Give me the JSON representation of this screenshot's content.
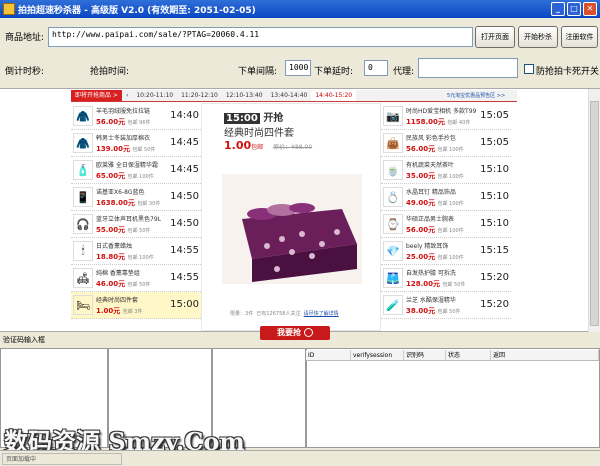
{
  "window": {
    "title": "拍拍超速秒杀器 - 高级版 V2.0 (有效期至: 2051-02-05)"
  },
  "form": {
    "url_label": "商品地址:",
    "url_value": "http://www.paipai.com/sale/?PTAG=20060.4.11",
    "countdown_label": "倒计时秒:",
    "snap_time_label": "抢拍时间:",
    "order_interval_label": "下单间隔:",
    "order_interval_value": "1000",
    "order_delay_label": "下单延时:",
    "order_delay_value": "0",
    "proxy_label": "代理:",
    "proxy_value": "",
    "prevent_freeze_label": "防抢拍卡死开关"
  },
  "buttons": {
    "open_page": "打开页面",
    "start_snap": "开始秒杀",
    "auth": "注册软件"
  },
  "tabs": {
    "lead": "即将开抢商品 >",
    "items": [
      "10:20-11:10",
      "11:20-12:10",
      "12:10-13:40",
      "13:40-14:40",
      "14:40-15:20"
    ],
    "active": 4,
    "link": "5元淘宝优惠品预告区 >>"
  },
  "left_items": [
    {
      "name": "羊毛羽绒服免拉拉链",
      "price": "56.00元",
      "sub": "包邮 96件",
      "time": "14:40",
      "icon": "coat-icon",
      "glyph": "🧥"
    },
    {
      "name": "韩男士冬装加厚棉衣",
      "price": "139.00元",
      "sub": "包邮 50件",
      "time": "14:45",
      "icon": "jacket-icon",
      "glyph": "🧥"
    },
    {
      "name": "欧莱雅 全日保湿精华霜",
      "price": "65.00元",
      "sub": "包邮 100件",
      "time": "14:45",
      "icon": "cream-icon",
      "glyph": "🧴"
    },
    {
      "name": "诺基亚X6-8G蓝色",
      "price": "1638.00元",
      "sub": "包邮 30件",
      "time": "14:50",
      "icon": "phone-icon",
      "glyph": "📱"
    },
    {
      "name": "蓝牙立体声耳机黑色79L",
      "price": "55.00元",
      "sub": "包邮 50件",
      "time": "14:50",
      "icon": "device-icon",
      "glyph": "🎧"
    },
    {
      "name": "日式香薰蜡烛",
      "price": "18.80元",
      "sub": "包邮 100件",
      "time": "14:55",
      "icon": "candle-icon",
      "glyph": "🕯"
    },
    {
      "name": "纯棉 香薰靠垫组",
      "price": "46.00元",
      "sub": "包邮 50件",
      "time": "14:55",
      "icon": "pillow-icon",
      "glyph": "🛋"
    },
    {
      "name": "经典时尚四件套",
      "price": "1.00元",
      "sub": "包邮 3件",
      "time": "15:00",
      "icon": "bedding-icon",
      "glyph": "🛏",
      "highlight": true
    }
  ],
  "right_items": [
    {
      "name": "时尚HD爱宝相机 多款T99",
      "price": "1158.00元",
      "sub": "包邮 40件",
      "time": "15:05",
      "icon": "camera-icon",
      "glyph": "📷"
    },
    {
      "name": "民族风 彩色手拎包",
      "price": "56.00元",
      "sub": "包邮 100件",
      "time": "15:05",
      "icon": "bag-icon",
      "glyph": "👜"
    },
    {
      "name": "有机蔬菜天然茶叶",
      "price": "35.00元",
      "sub": "包邮 100件",
      "time": "15:10",
      "icon": "tea-icon",
      "glyph": "🍵"
    },
    {
      "name": "水晶耳钉 精品饰品",
      "price": "49.00元",
      "sub": "包邮 100件",
      "time": "15:10",
      "icon": "earring-icon",
      "glyph": "💍"
    },
    {
      "name": "华硕正品男士腕表",
      "price": "56.00元",
      "sub": "包邮 100件",
      "time": "15:10",
      "icon": "watch-icon",
      "glyph": "⌚"
    },
    {
      "name": "beely 精致耳饰",
      "price": "25.00元",
      "sub": "包邮 100件",
      "time": "15:15",
      "icon": "jewel-icon",
      "glyph": "💎"
    },
    {
      "name": "自发热护膝 可拆洗",
      "price": "128.00元",
      "sub": "包邮 50件",
      "time": "15:20",
      "icon": "knee-icon",
      "glyph": "🩳"
    },
    {
      "name": "兰芝 水酷保湿精华",
      "price": "38.00元",
      "sub": "包邮 50件",
      "time": "15:20",
      "icon": "essence-icon",
      "glyph": "🧪"
    }
  ],
  "featured": {
    "time": "15:00",
    "time_suffix": "开抢",
    "title": "经典时尚四件套",
    "price": "1.00",
    "unit": "包邮",
    "old": "原价：¥88.00",
    "meta": "限量：3件",
    "meta2": "已有126758人关注",
    "link": "请尽快了解详情",
    "buy": "我要抢"
  },
  "captcha": {
    "label": "验证码输入框"
  },
  "grid": {
    "columns": [
      "ID",
      "verifysession",
      "识别码",
      "状态",
      "返回"
    ]
  },
  "status": {
    "text": "页面加载中"
  },
  "watermark": "数码资源 Smzy.Com",
  "colors": {
    "accent": "#d01010",
    "titlebar": "#0a46c4"
  }
}
